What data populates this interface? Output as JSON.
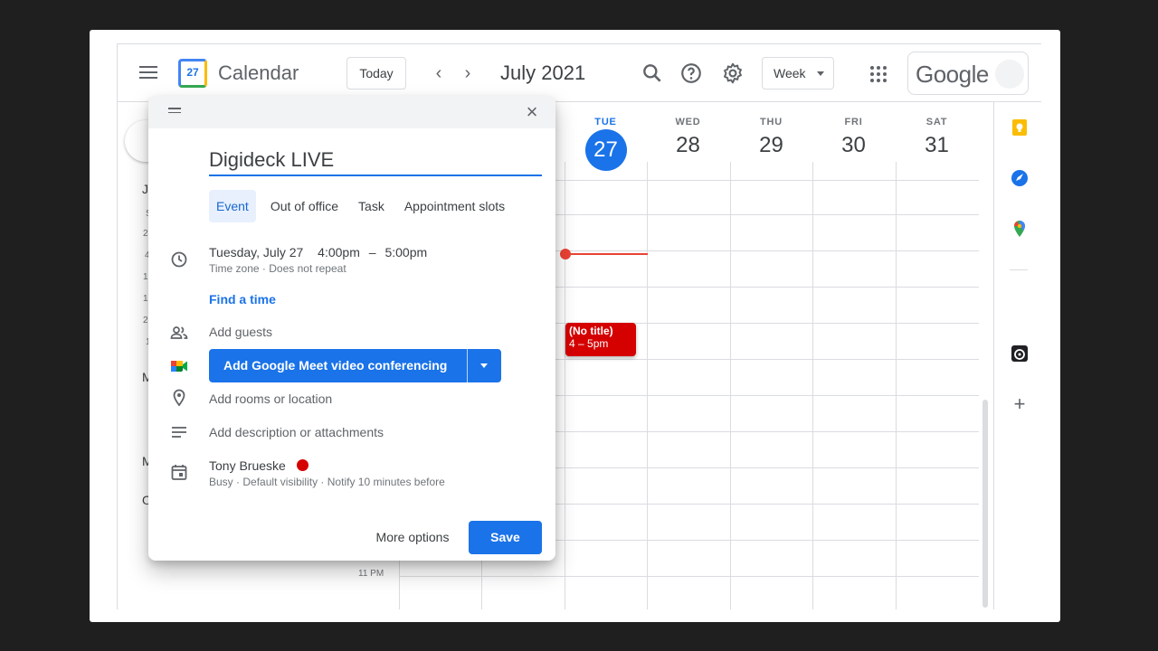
{
  "header": {
    "app_title": "Calendar",
    "logo_date": "27",
    "today_label": "Today",
    "prev_icon": "chevron-left-icon",
    "next_icon": "chevron-right-icon",
    "month_title": "July 2021",
    "view_label": "Week",
    "brand": "Google"
  },
  "sidebar": {
    "month_initial": "J",
    "weekday_initial": "S",
    "dates": [
      "2",
      "4",
      "1",
      "1",
      "2",
      "1"
    ],
    "section_initial_1": "M",
    "section_initial_2": "M",
    "section_initial_3": "O"
  },
  "week": {
    "days": [
      {
        "dow": "TUE",
        "dom": "27",
        "today": true
      },
      {
        "dow": "WED",
        "dom": "28",
        "today": false
      },
      {
        "dow": "THU",
        "dom": "29",
        "today": false
      },
      {
        "dow": "FRI",
        "dom": "30",
        "today": false
      },
      {
        "dow": "SAT",
        "dom": "31",
        "today": false
      }
    ],
    "time_label": "11 PM",
    "event": {
      "title": "(No title)",
      "time": "4 – 5pm",
      "color": "#d50000"
    }
  },
  "colors": {
    "accent": "#1a73e8",
    "event_red": "#d50000",
    "now_line": "#ea4335"
  },
  "dialog": {
    "title_value": "Digideck LIVE",
    "tabs": [
      "Event",
      "Out of office",
      "Task",
      "Appointment slots"
    ],
    "active_tab": "Event",
    "date_text": "Tuesday, July 27",
    "time_start": "4:00pm",
    "time_sep": "–",
    "time_end": "5:00pm",
    "tz_text": "Time zone",
    "repeat_text": "Does not repeat",
    "find_time": "Find a time",
    "add_guests": "Add guests",
    "meet_button": "Add Google Meet video conferencing",
    "add_location": "Add rooms or location",
    "add_description": "Add description or attachments",
    "owner": "Tony Brueske",
    "status_busy": "Busy",
    "status_visibility": "Default visibility",
    "status_notify": "Notify 10 minutes before",
    "more_options": "More options",
    "save": "Save"
  }
}
